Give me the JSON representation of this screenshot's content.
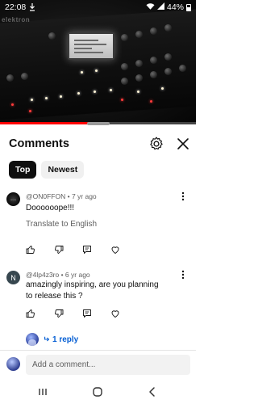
{
  "status_bar": {
    "time": "22:08",
    "battery": "44%",
    "icons": [
      "download-icon",
      "wifi-icon",
      "signal-icon",
      "battery-icon"
    ]
  },
  "video": {
    "brand_text": "elektron",
    "progress_fraction": 0.5
  },
  "sheet": {
    "title": "Comments",
    "icons": [
      "settings-icon",
      "close-icon"
    ]
  },
  "sort_chips": [
    {
      "label": "Top",
      "active": true
    },
    {
      "label": "Newest",
      "active": false
    }
  ],
  "comments": [
    {
      "author": "@ON0FFON",
      "age": "7 yr ago",
      "author_line": "@ON0FFON • 7 yr ago",
      "text": "Doooooope!!!",
      "translate_label": "Translate to English"
    },
    {
      "author": "@4lp4z3ro",
      "age": "6 yr ago",
      "author_line": "@4lp4z3ro • 6 yr ago",
      "avatar_letter": "N",
      "avatar_color": "#37474f",
      "text": "amazingly inspiring, are you planning to release this ?",
      "replies_label": "1 reply"
    }
  ],
  "composer": {
    "placeholder": "Add a comment..."
  },
  "colors": {
    "accent_link": "#065fd4",
    "progress": "#ff0000",
    "chip_active": "#0f0f0f"
  }
}
